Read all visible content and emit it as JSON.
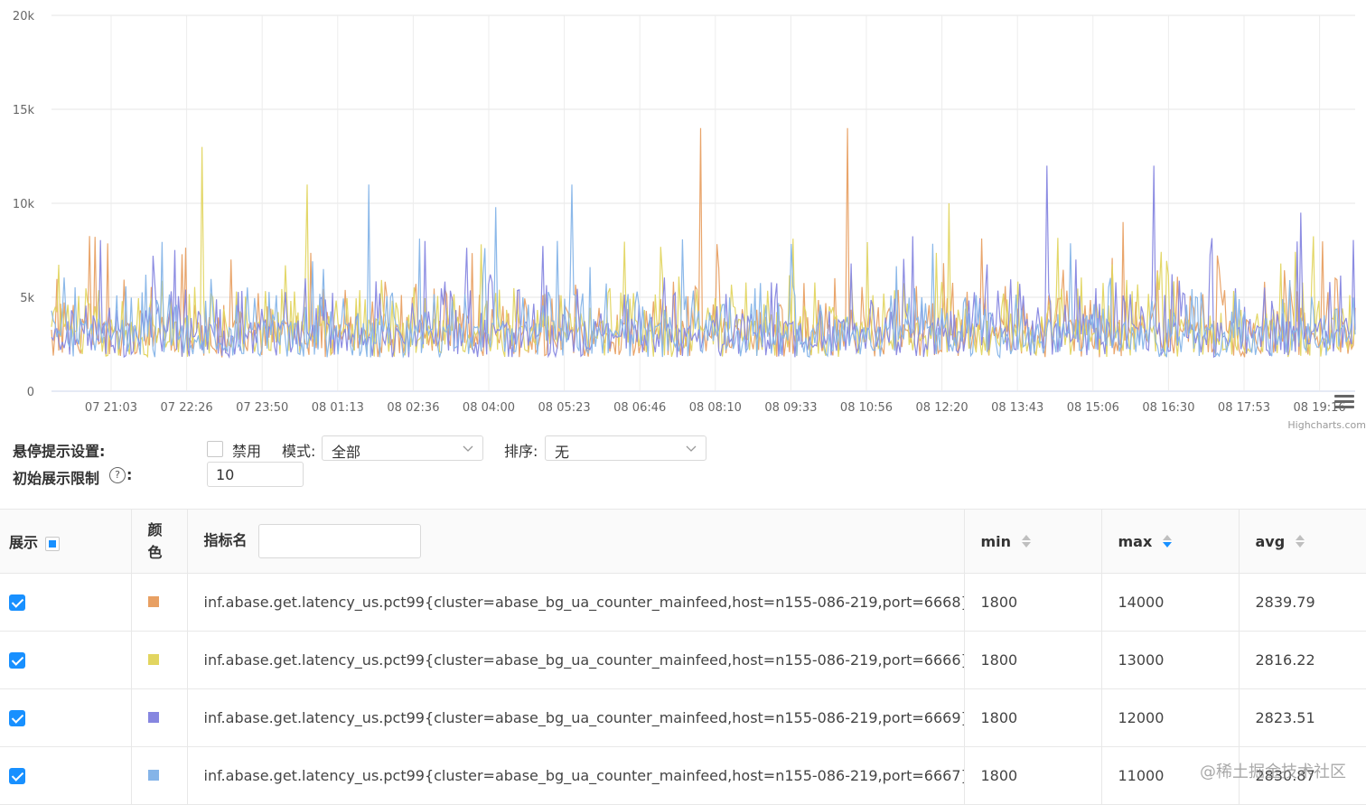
{
  "chart_data": {
    "type": "line",
    "yticks": [
      "20k",
      "15k",
      "10k",
      "5k",
      "0"
    ],
    "ylim": [
      0,
      20000
    ],
    "xticks": [
      "07 21:03",
      "07 22:26",
      "07 23:50",
      "08 01:13",
      "08 02:36",
      "08 04:00",
      "08 05:23",
      "08 06:46",
      "08 08:10",
      "08 09:33",
      "08 10:56",
      "08 12:20",
      "08 13:43",
      "08 15:06",
      "08 16:30",
      "08 17:53",
      "08 19:16"
    ],
    "grid": true,
    "credits": "Highcharts.com",
    "series": [
      {
        "name": "inf.abase.get.latency_us.pct99{cluster=abase_bg_ua_counter_mainfeed,host=n155-086-219,port=6668}",
        "color": "#e8a063",
        "min": 1800,
        "max": 14000,
        "avg": 2839.79,
        "peaks_x": [
          7.8,
          9.75,
          13.4
        ],
        "peaks_y": [
          8000,
          14000,
          9000
        ]
      },
      {
        "name": "inf.abase.get.latency_us.pct99{cluster=abase_bg_ua_counter_mainfeed,host=n155-086-219,port=6666}",
        "color": "#e2d560",
        "min": 1800,
        "max": 13000,
        "avg": 2816.22,
        "peaks_x": [
          1.2,
          2.6,
          11.1
        ],
        "peaks_y": [
          13000,
          11000,
          10000
        ]
      },
      {
        "name": "inf.abase.get.latency_us.pct99{cluster=abase_bg_ua_counter_mainfeed,host=n155-086-219,port=6669}",
        "color": "#8686e0",
        "min": 1800,
        "max": 12000,
        "avg": 2823.51,
        "peaks_x": [
          12.4,
          13.8,
          15.75
        ],
        "peaks_y": [
          12000,
          12000,
          9500
        ]
      },
      {
        "name": "inf.abase.get.latency_us.pct99{cluster=abase_bg_ua_counter_mainfeed,host=n155-086-219,port=6667}",
        "color": "#85b4e8",
        "min": 1800,
        "max": 11000,
        "avg": 2830.87,
        "peaks_x": [
          3.4,
          5.1,
          6.1
        ],
        "peaks_y": [
          10000,
          9800,
          11000
        ]
      }
    ]
  },
  "settings": {
    "hover_label": "悬停提示设置:",
    "disable_label": "禁用",
    "mode_label": "模式:",
    "mode_value": "全部",
    "sort_label": "排序:",
    "sort_value": "无",
    "limit_label": "初始展示限制",
    "limit_colon": ":",
    "limit_value": "10"
  },
  "table": {
    "headers": {
      "show": "展示",
      "color_1": "颜",
      "color_2": "色",
      "name": "指标名",
      "min": "min",
      "max": "max",
      "avg": "avg"
    },
    "rows": [
      {
        "name": "inf.abase.get.latency_us.pct99{cluster=abase_bg_ua_counter_mainfeed,host=n155-086-219,port=6668}",
        "min": "1800",
        "max": "14000",
        "avg": "2839.79"
      },
      {
        "name": "inf.abase.get.latency_us.pct99{cluster=abase_bg_ua_counter_mainfeed,host=n155-086-219,port=6666}",
        "min": "1800",
        "max": "13000",
        "avg": "2816.22"
      },
      {
        "name": "inf.abase.get.latency_us.pct99{cluster=abase_bg_ua_counter_mainfeed,host=n155-086-219,port=6669}",
        "min": "1800",
        "max": "12000",
        "avg": "2823.51"
      },
      {
        "name": "inf.abase.get.latency_us.pct99{cluster=abase_bg_ua_counter_mainfeed,host=n155-086-219,port=6667}",
        "min": "1800",
        "max": "11000",
        "avg": "2830.87"
      }
    ]
  },
  "watermark": "@稀土掘金技术社区"
}
